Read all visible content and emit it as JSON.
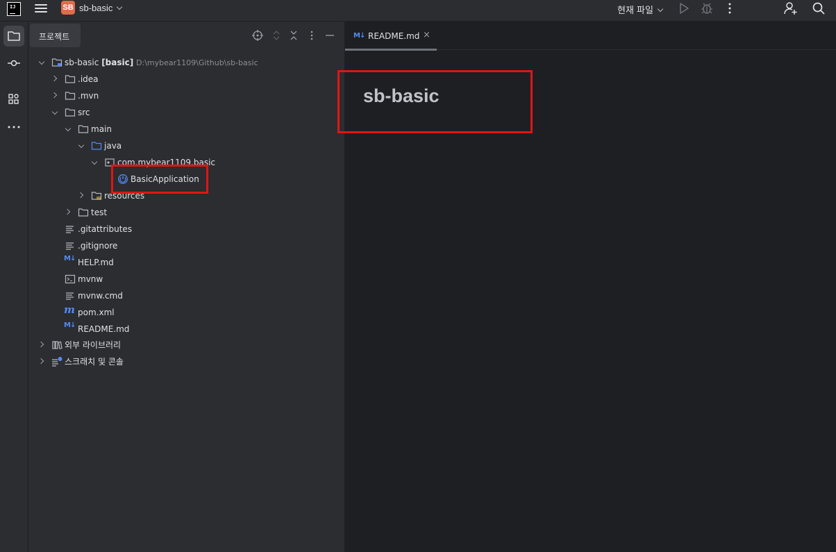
{
  "titlebar": {
    "project_badge": "SB",
    "project_name": "sb-basic",
    "run_config": "현재 파일"
  },
  "panel": {
    "tab_label": "프로젝트"
  },
  "tree": {
    "root_name": "sb-basic",
    "root_module": "[basic]",
    "root_path": "D:\\mybear1109\\Github\\sb-basic",
    "idea": ".idea",
    "mvn": ".mvn",
    "src": "src",
    "main": "main",
    "java": "java",
    "package": "com.mybear1109.basic",
    "app_class": "BasicApplication",
    "resources": "resources",
    "test": "test",
    "gitattributes": ".gitattributes",
    "gitignore": ".gitignore",
    "help_md": "HELP.md",
    "mvnw": "mvnw",
    "mvnw_cmd": "mvnw.cmd",
    "pom": "pom.xml",
    "readme": "README.md",
    "external_libs": "외부 라이브러리",
    "scratches": "스크래치 및 콘솔",
    "md_badge": "M↓",
    "pom_badge": "m"
  },
  "editor": {
    "tab_badge": "M↓",
    "tab_title": "README.md",
    "tab_close": "×",
    "heading": "sb-basic"
  },
  "colors": {
    "highlight": "#e01515",
    "accent_blue": "#548af7",
    "badge_orange": "#e06c4b"
  }
}
